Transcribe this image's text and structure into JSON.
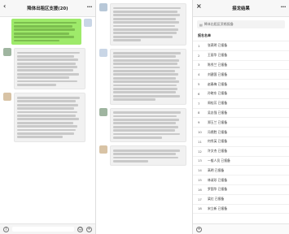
{
  "left": {
    "title": "降体出租区支援(20)"
  },
  "middle": {
    "title": ""
  },
  "right": {
    "title": "接龙结果",
    "search_label": "降体出租区资格报备",
    "section_label": "报名名单",
    "rows": [
      {
        "num": "1",
        "text": "张燕明 已报备"
      },
      {
        "num": "2",
        "text": "王丽华 已报备"
      },
      {
        "num": "3",
        "text": "陈秀兰 已报备"
      },
      {
        "num": "4",
        "text": "刘建国 已报备"
      },
      {
        "num": "5",
        "text": "赵春梅 已报备"
      },
      {
        "num": "6",
        "text": "孙晓东 已报备"
      },
      {
        "num": "7",
        "text": "周桂芳 已报备"
      },
      {
        "num": "8",
        "text": "吴志强 已报备"
      },
      {
        "num": "9",
        "text": "郑玉兰 已报备"
      },
      {
        "num": "10",
        "text": "冯德胜 已报备"
      },
      {
        "num": "11",
        "text": "何秀英 已报备"
      },
      {
        "num": "12",
        "text": "许文杰 已报备"
      },
      {
        "num": "13",
        "text": "一般人员 已报备"
      },
      {
        "num": "14",
        "text": "高明 已报备"
      },
      {
        "num": "15",
        "text": "林淑珍 已报备"
      },
      {
        "num": "16",
        "text": "罗国华 已报备"
      },
      {
        "num": "17",
        "text": "梁红 已报备"
      },
      {
        "num": "18",
        "text": "宋立新 已报备"
      }
    ]
  }
}
